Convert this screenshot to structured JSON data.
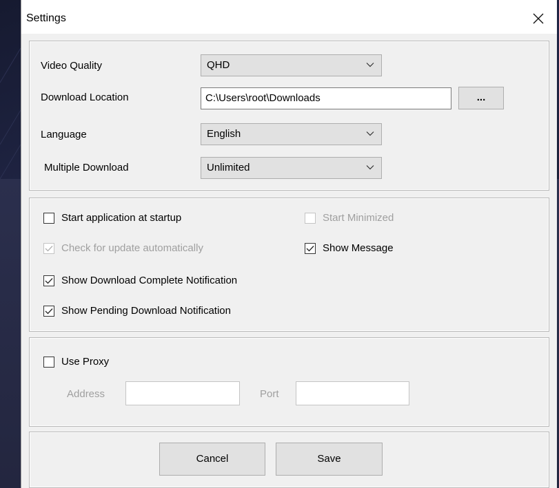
{
  "window": {
    "title": "Settings"
  },
  "general": {
    "video_quality": {
      "label": "Video Quality",
      "value": "QHD"
    },
    "download_location": {
      "label": "Download Location",
      "value": "C:\\Users\\root\\Downloads",
      "browse_label": "..."
    },
    "language": {
      "label": "Language",
      "value": "English"
    },
    "multiple_download": {
      "label": "Multiple Download",
      "value": "Unlimited"
    }
  },
  "options": {
    "start_at_startup": {
      "label": "Start application at startup",
      "checked": false,
      "enabled": true
    },
    "start_minimized": {
      "label": "Start Minimized",
      "checked": false,
      "enabled": false
    },
    "check_update": {
      "label": "Check for update automatically",
      "checked": true,
      "enabled": false
    },
    "show_message": {
      "label": "Show Message",
      "checked": true,
      "enabled": true
    },
    "show_download_complete": {
      "label": "Show Download Complete Notification",
      "checked": true,
      "enabled": true
    },
    "show_pending_download": {
      "label": "Show Pending Download Notification",
      "checked": true,
      "enabled": true
    }
  },
  "proxy": {
    "use_proxy": {
      "label": "Use Proxy",
      "checked": false
    },
    "address_label": "Address",
    "address_value": "",
    "port_label": "Port",
    "port_value": ""
  },
  "actions": {
    "cancel_label": "Cancel",
    "save_label": "Save"
  },
  "colors": {
    "dialog_bg": "#f0f0f0",
    "desktop_bg": "#1c1f35",
    "disabled_text": "#9f9f9f"
  }
}
